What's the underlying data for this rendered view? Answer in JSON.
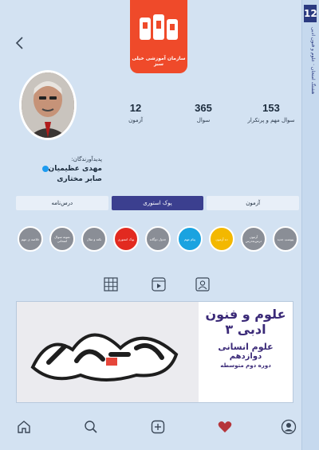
{
  "spine": {
    "number": "12",
    "text": "هشتگ امتحان · علوم و فنون ادبی"
  },
  "logo": {
    "caption": "سازمان آموزشی خیلی سبز"
  },
  "stats": [
    {
      "value": "153",
      "label": "سوال مهم و پرتکرار"
    },
    {
      "value": "365",
      "label": "سوال"
    },
    {
      "value": "12",
      "label": "آزمون"
    }
  ],
  "creators": {
    "heading": "پدیدآورندگان:",
    "names": [
      "مهدی عظیمیان",
      "صابر مختاری"
    ]
  },
  "tabs": [
    {
      "label": "آزمون"
    },
    {
      "label": "پوک استوری"
    },
    {
      "label": "درس‌نامه"
    }
  ],
  "highlights": [
    {
      "label": "پیوستِ جدید",
      "color": "#8a8e96"
    },
    {
      "label": "آزمون درس‌به‌درس",
      "color": "#8a8e96"
    },
    {
      "label": "ده آزمون",
      "color": "#f3b800"
    },
    {
      "label": "پیام مهم",
      "color": "#1aa3e0"
    },
    {
      "label": "جدول دوگانه",
      "color": "#8a8e96"
    },
    {
      "label": "پوک استوری",
      "color": "#e22a20"
    },
    {
      "label": "نکته و مثال",
      "color": "#8a8e96"
    },
    {
      "label": "نمونه سوال امتحانی",
      "color": "#8a8e96"
    },
    {
      "label": "خلاصه ی مهم",
      "color": "#8a8e96"
    }
  ],
  "banner": {
    "brand_art": "هشتگ امتحان",
    "title": "علوم و فنون ادبی ۳",
    "subject": "علوم انسانی",
    "grade": "دوازدهم",
    "level": "دوره دوم متوسطه"
  },
  "colors": {
    "accent": "#3b3f8f",
    "brand": "#ef4a2a",
    "background": "#d3e2f2"
  }
}
